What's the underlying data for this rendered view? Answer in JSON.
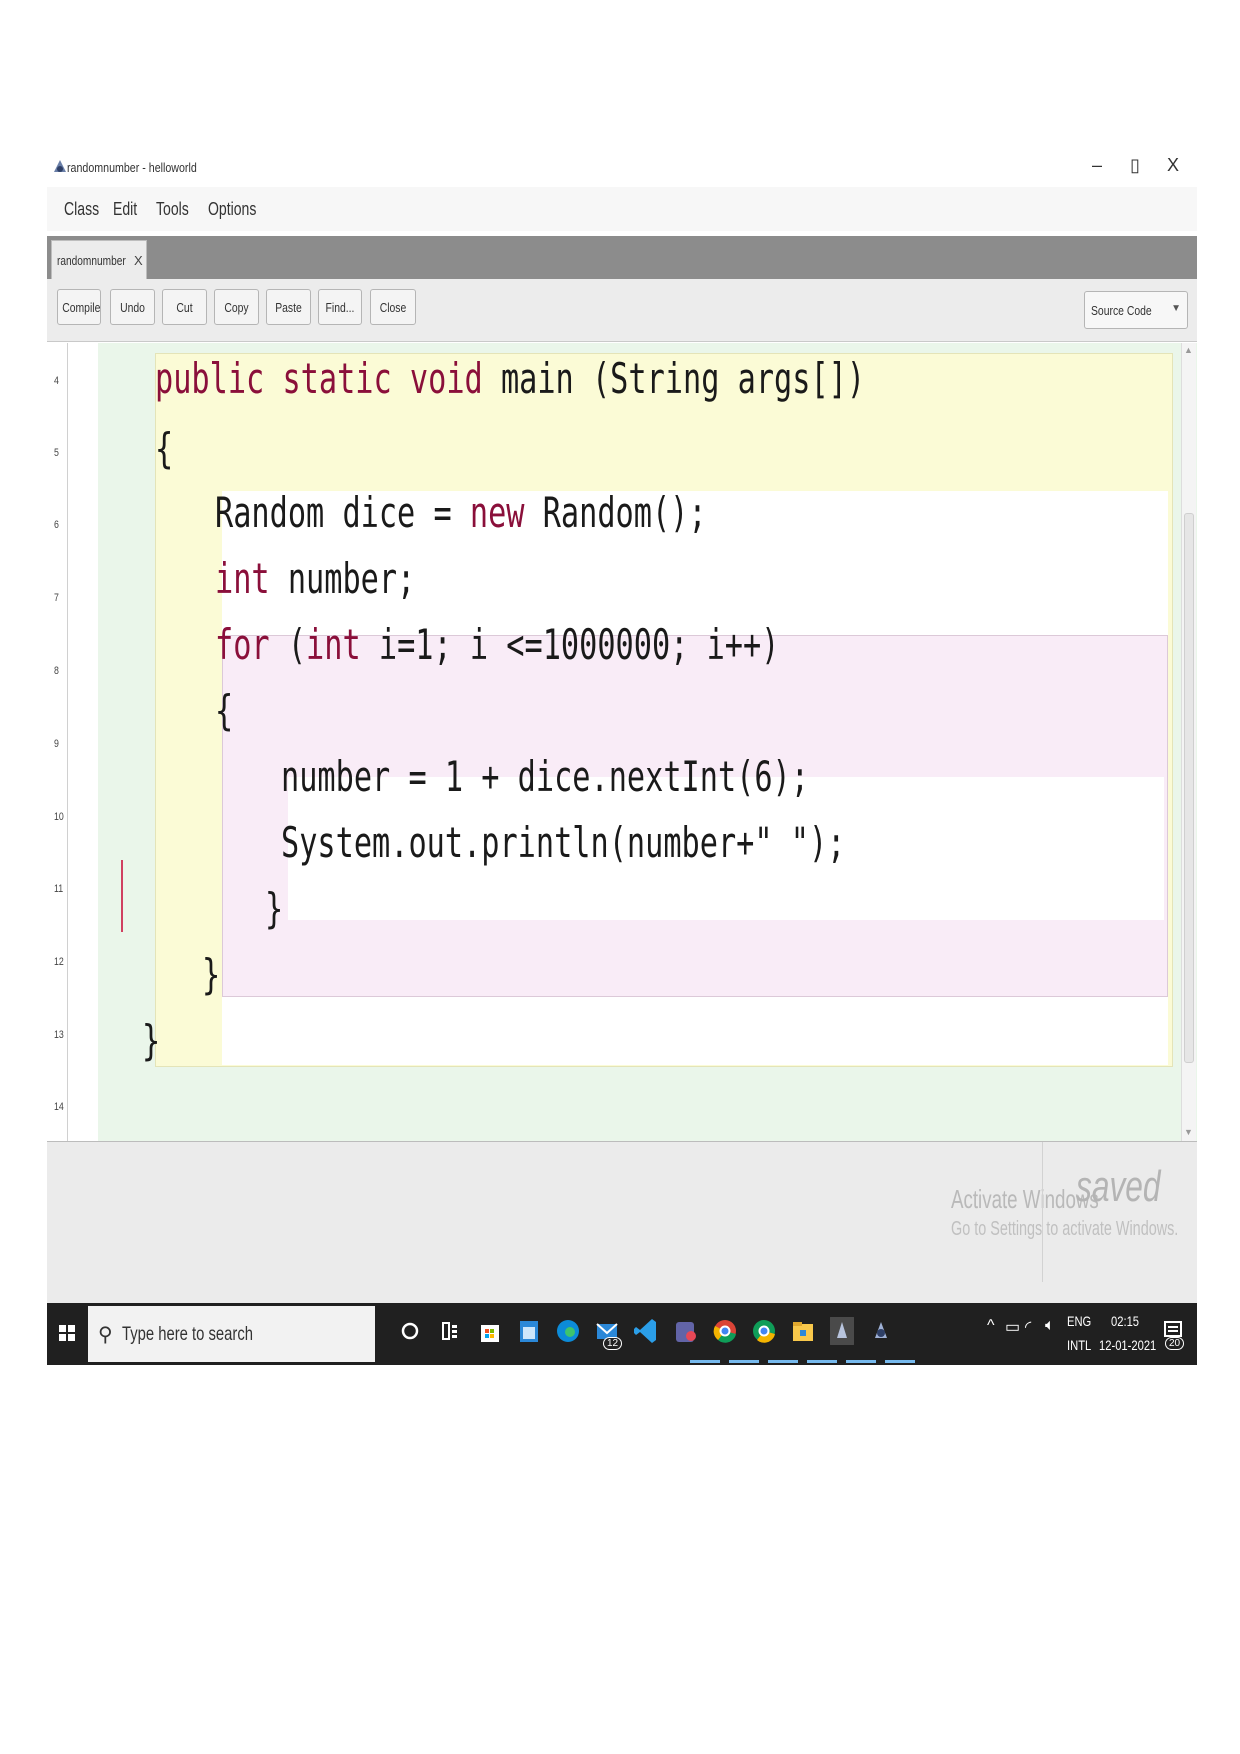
{
  "window": {
    "title": "randomnumber - helloworld",
    "controls": {
      "minimize": "–",
      "maximize": "▯",
      "close": "X"
    }
  },
  "menu": {
    "items": [
      "Class",
      "Edit",
      "Tools",
      "Options"
    ]
  },
  "tab": {
    "label": "randomnumber",
    "close": "X"
  },
  "toolbar": {
    "buttons": [
      "Compile",
      "Undo",
      "Cut",
      "Copy",
      "Paste",
      "Find...",
      "Close"
    ],
    "view_select": "Source Code"
  },
  "editor": {
    "line_numbers": [
      "4",
      "5",
      "6",
      "7",
      "8",
      "9",
      "10",
      "11",
      "12",
      "13",
      "14"
    ],
    "lines": {
      "l4": {
        "kw1": "public",
        "kw2": "static",
        "kw3": "void",
        "rest": " main (String args[])"
      },
      "l5": "{",
      "l6": {
        "a": "Random dice = ",
        "kw": "new",
        "b": " Random();"
      },
      "l7": {
        "kw": "int",
        "rest": " number;"
      },
      "l8": {
        "kw1": "for",
        "mid": " (",
        "kw2": "int",
        "rest": " i=1; i <=1000000; i++)"
      },
      "l9": "{",
      "l10": "number = 1 + dice.nextInt(6);",
      "l11": "System.out.println(number+\" \");",
      "l12": "}",
      "l13": "}",
      "l14": "}"
    }
  },
  "status": {
    "watermark_line1": "Activate Windows",
    "watermark_line2": "Go to Settings to activate Windows.",
    "saved": "saved"
  },
  "taskbar": {
    "search_placeholder": "Type here to search",
    "mail_badge": "12",
    "language_top": "ENG",
    "language_bottom": "INTL",
    "time": "02:15",
    "date": "12-01-2021",
    "notification_count": "20"
  }
}
